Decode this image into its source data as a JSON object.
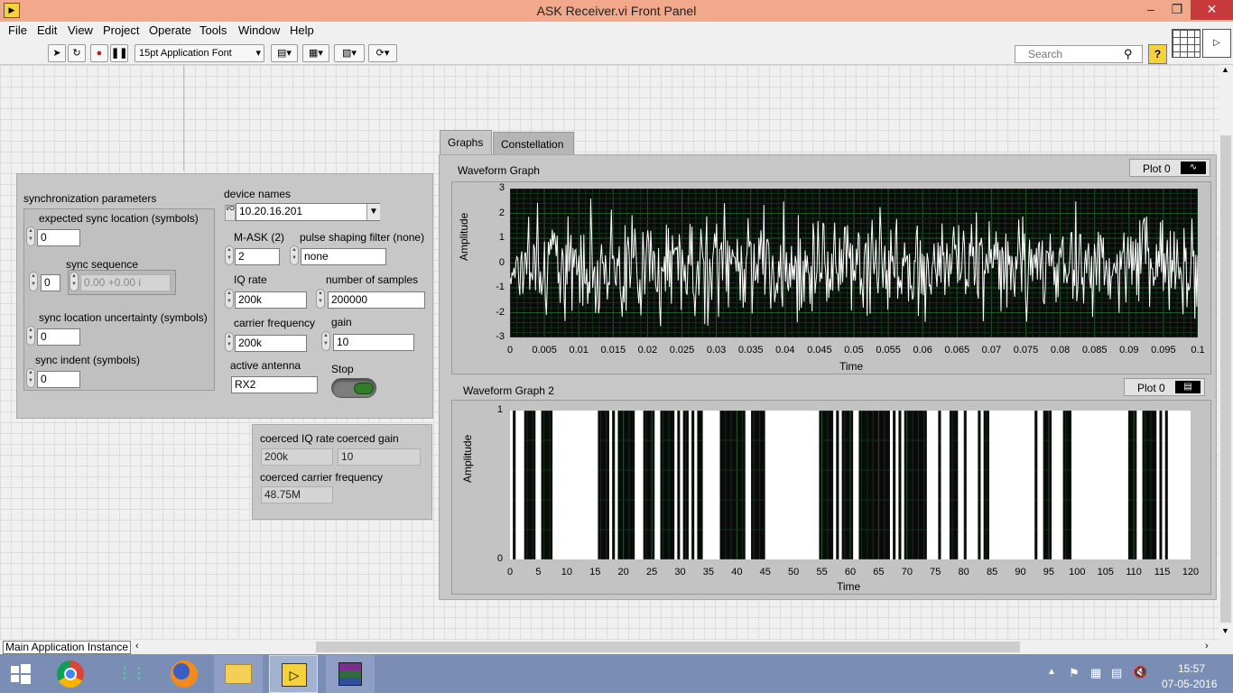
{
  "window": {
    "title": "ASK Receiver.vi Front Panel"
  },
  "menu": [
    "File",
    "Edit",
    "View",
    "Project",
    "Operate",
    "Tools",
    "Window",
    "Help"
  ],
  "toolbar": {
    "font_label": "15pt Application Font",
    "search_placeholder": "Search",
    "help_label": "?"
  },
  "sync": {
    "title": "synchronization parameters",
    "expected_label": "expected sync location (symbols)",
    "expected_value": "0",
    "sequence_label": "sync sequence",
    "sequence_index": "0",
    "sequence_value": "0.00 +0.00 i",
    "uncertainty_label": "sync location uncertainty (symbols)",
    "uncertainty_value": "0",
    "indent_label": "sync indent (symbols)",
    "indent_value": "0"
  },
  "device": {
    "names_label": "device names",
    "names_value": "10.20.16.201",
    "io_glyph": "I/O",
    "mask_label": "M-ASK (2)",
    "mask_value": "2",
    "pulse_label": "pulse shaping filter (none)",
    "pulse_value": "none",
    "iq_label": "IQ rate",
    "iq_value": "200k",
    "samples_label": "number of samples",
    "samples_value": "200000",
    "carrier_label": "carrier frequency",
    "carrier_value": "200k",
    "gain_label": "gain",
    "gain_value": "10",
    "antenna_label": "active antenna",
    "antenna_value": "RX2",
    "stop_label": "Stop"
  },
  "coerced": {
    "iq_label": "coerced IQ rate",
    "iq_value": "200k",
    "gain_label": "coerced gain",
    "gain_value": "10",
    "carrier_label": "coerced carrier frequency",
    "carrier_value": "48.75M"
  },
  "tabs": {
    "graphs": "Graphs",
    "constellation": "Constellation"
  },
  "graph1": {
    "title": "Waveform Graph",
    "legend": "Plot 0",
    "xlabel": "Time",
    "ylabel": "Amplitude",
    "yticks": [
      "3",
      "2",
      "1",
      "0",
      "-1",
      "-2",
      "-3"
    ],
    "xticks": [
      "0",
      "0.005",
      "0.01",
      "0.015",
      "0.02",
      "0.025",
      "0.03",
      "0.035",
      "0.04",
      "0.045",
      "0.05",
      "0.055",
      "0.06",
      "0.065",
      "0.07",
      "0.075",
      "0.08",
      "0.085",
      "0.09",
      "0.095",
      "0.1"
    ]
  },
  "graph2": {
    "title": "Waveform Graph 2",
    "legend": "Plot 0",
    "xlabel": "Time",
    "ylabel": "Amplitude",
    "yticks": [
      "1",
      "0"
    ],
    "xticks": [
      "0",
      "5",
      "10",
      "15",
      "20",
      "25",
      "30",
      "35",
      "40",
      "45",
      "50",
      "55",
      "60",
      "65",
      "70",
      "75",
      "80",
      "85",
      "90",
      "95",
      "100",
      "105",
      "110",
      "115",
      "120"
    ]
  },
  "chart_data": [
    {
      "type": "line",
      "title": "Waveform Graph",
      "xlabel": "Time",
      "ylabel": "Amplitude",
      "xlim": [
        0,
        0.1
      ],
      "ylim": [
        -3,
        3
      ],
      "grid": true,
      "legend": "top-right",
      "series": [
        {
          "name": "Plot 0",
          "description": "noise-like signal centred at 0",
          "typical_range": [
            -1,
            1
          ],
          "extremes": [
            -2.6,
            2.6
          ]
        }
      ]
    },
    {
      "type": "line",
      "title": "Waveform Graph 2",
      "xlabel": "Time",
      "ylabel": "Amplitude",
      "xlim": [
        0,
        120
      ],
      "ylim": [
        0,
        1
      ],
      "grid": true,
      "legend": "top-right",
      "series": [
        {
          "name": "Plot 0",
          "zero_intervals": [
            [
              0.5,
              1
            ],
            [
              2.5,
              4.5
            ],
            [
              5.5,
              7.5
            ],
            [
              15.5,
              17.5
            ],
            [
              18,
              18.5
            ],
            [
              19,
              22
            ],
            [
              23.5,
              25.5
            ],
            [
              26.5,
              29
            ],
            [
              29.5,
              30
            ],
            [
              30.5,
              31.5
            ],
            [
              32,
              32.5
            ],
            [
              33,
              34
            ],
            [
              37,
              41.5
            ],
            [
              42.5,
              45
            ],
            [
              54.5,
              57
            ],
            [
              57.5,
              58
            ],
            [
              58.5,
              60.5
            ],
            [
              61.5,
              67
            ],
            [
              67.5,
              68
            ],
            [
              68.5,
              69
            ],
            [
              69.5,
              73.5
            ],
            [
              75.5,
              76
            ],
            [
              77.5,
              79
            ],
            [
              80,
              80.5
            ],
            [
              82.5,
              83
            ],
            [
              83.5,
              84.5
            ],
            [
              92.5,
              93
            ],
            [
              94,
              95.5
            ],
            [
              97.5,
              99
            ],
            [
              109,
              110.5
            ],
            [
              111.5,
              114
            ],
            [
              114.5,
              115
            ],
            [
              115.5,
              116
            ]
          ]
        }
      ]
    }
  ],
  "status": {
    "context": "Main Application Instance"
  },
  "clock": {
    "time": "15:57",
    "date": "07-05-2016"
  }
}
